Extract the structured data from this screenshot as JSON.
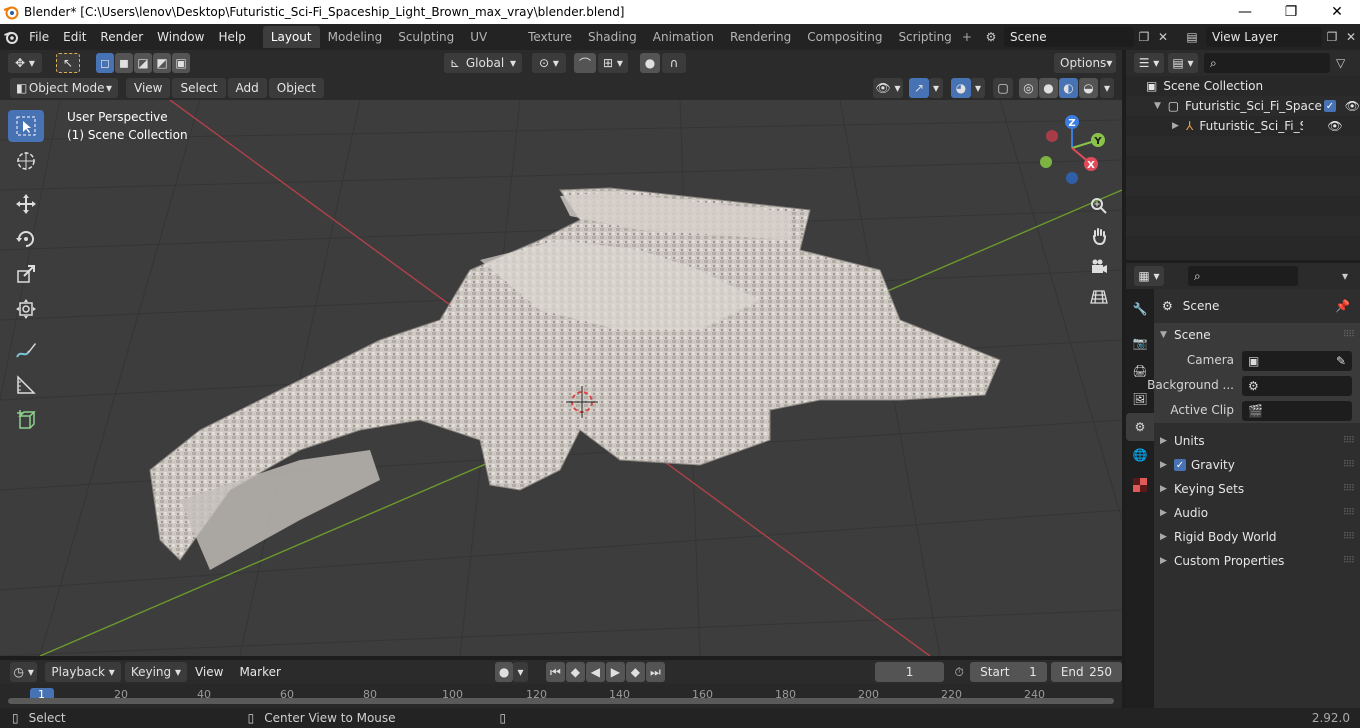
{
  "window": {
    "title": "Blender* [C:\\Users\\lenov\\Desktop\\Futuristic_Sci-Fi_Spaceship_Light_Brown_max_vray\\blender.blend]",
    "minimize": "—",
    "maximize": "❐",
    "close": "✕"
  },
  "menu": [
    "File",
    "Edit",
    "Render",
    "Window",
    "Help"
  ],
  "workspaces": [
    "Layout",
    "Modeling",
    "Sculpting",
    "UV Editing",
    "Texture Paint",
    "Shading",
    "Animation",
    "Rendering",
    "Compositing",
    "Scripting"
  ],
  "active_workspace": "Layout",
  "scene_field": "Scene",
  "view_layer_field": "View Layer",
  "tool_header": {
    "transform_orientation": "Global",
    "options": "Options"
  },
  "viewport_header": {
    "mode": "Object Mode",
    "menus": [
      "View",
      "Select",
      "Add",
      "Object"
    ]
  },
  "viewport": {
    "perspective": "User Perspective",
    "collection": "(1) Scene Collection",
    "gizmo": {
      "x": "X",
      "y": "Y",
      "z": "Z"
    },
    "colors": {
      "x": "#e04a5b",
      "y": "#8bc34a",
      "z": "#3b7de0"
    }
  },
  "outliner": {
    "root": "Scene Collection",
    "collection": "Futuristic_Sci_Fi_Spaces",
    "object": "Futuristic_Sci_Fi_Spa"
  },
  "properties": {
    "context": "Scene",
    "panel": "Scene",
    "camera_label": "Camera",
    "background_label": "Background ...",
    "clip_label": "Active Clip",
    "sections": [
      "Units",
      "Gravity",
      "Keying Sets",
      "Audio",
      "Rigid Body World",
      "Custom Properties"
    ]
  },
  "timeline": {
    "menus": [
      "Playback",
      "Keying",
      "View",
      "Marker"
    ],
    "current_frame": "1",
    "start_label": "Start",
    "start_value": "1",
    "end_label": "End",
    "end_value": "250",
    "ruler": [
      "1",
      "20",
      "40",
      "60",
      "80",
      "100",
      "120",
      "140",
      "160",
      "180",
      "200",
      "220",
      "240"
    ]
  },
  "status": {
    "select": "Select",
    "center": "Center View to Mouse",
    "version": "2.92.0"
  },
  "accent": "#4772b3"
}
